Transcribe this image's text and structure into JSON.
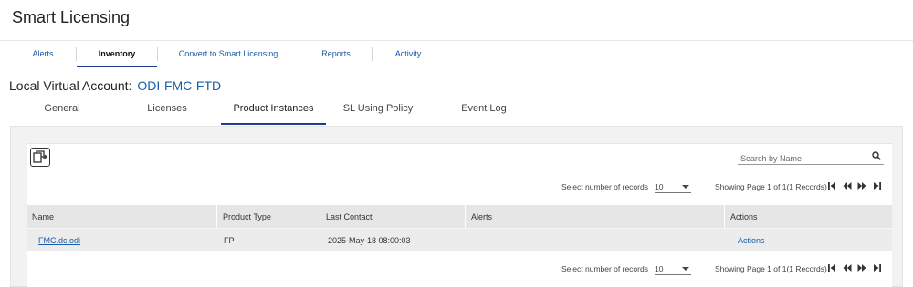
{
  "page": {
    "title": "Smart Licensing"
  },
  "top_tabs": [
    {
      "label": "Alerts"
    },
    {
      "label": "Inventory",
      "active": true
    },
    {
      "label": "Convert to Smart Licensing"
    },
    {
      "label": "Reports"
    },
    {
      "label": "Activity"
    }
  ],
  "account": {
    "label": "Local Virtual Account:",
    "name": "ODI-FMC-FTD"
  },
  "sub_tabs": [
    {
      "label": "General"
    },
    {
      "label": "Licenses"
    },
    {
      "label": "Product Instances",
      "active": true
    },
    {
      "label": "SL Using Policy"
    },
    {
      "label": "Event Log"
    }
  ],
  "search": {
    "placeholder": "Search by Name"
  },
  "pager": {
    "records_label": "Select number of records",
    "records_value": "10",
    "showing": "Showing Page 1 of 1(1 Records)"
  },
  "table": {
    "headers": [
      "Name",
      "Product Type",
      "Last Contact",
      "Alerts",
      "Actions"
    ],
    "rows": [
      {
        "name": "FMC.dc.odi",
        "product_type": "FP",
        "last_contact": "2025-May-18 08:00:03",
        "alerts": "",
        "actions": "Actions"
      }
    ]
  },
  "colors": {
    "accent": "#1f3e8c",
    "link": "#1a5ea8"
  }
}
